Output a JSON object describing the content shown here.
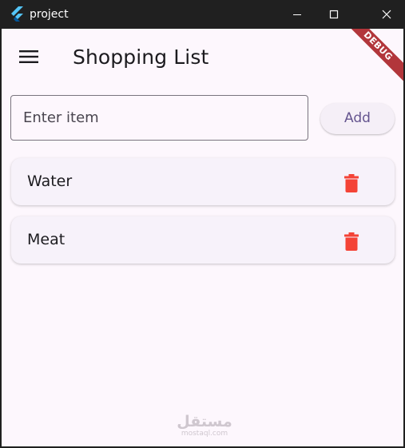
{
  "window": {
    "title": "project",
    "icon": "flutter-logo-icon",
    "controls": [
      "minimize-icon",
      "maximize-icon",
      "close-icon"
    ]
  },
  "appbar": {
    "title": "Shopping List",
    "menu_icon": "menu-icon",
    "debug_banner": "DEBUG"
  },
  "form": {
    "input_value": "",
    "input_placeholder": "Enter item",
    "add_label": "Add"
  },
  "items": [
    {
      "label": "Water",
      "action_icon": "trash-icon"
    },
    {
      "label": "Meat",
      "action_icon": "trash-icon"
    }
  ],
  "watermark": {
    "main": "مستقل",
    "sub": "mostaql.com"
  },
  "colors": {
    "background": "#fdf7fd",
    "card": "#f7f2fa",
    "primary_text": "#1c1b1f",
    "accent": "#65558f",
    "delete": "#f44336",
    "debug": "#b2363b"
  }
}
